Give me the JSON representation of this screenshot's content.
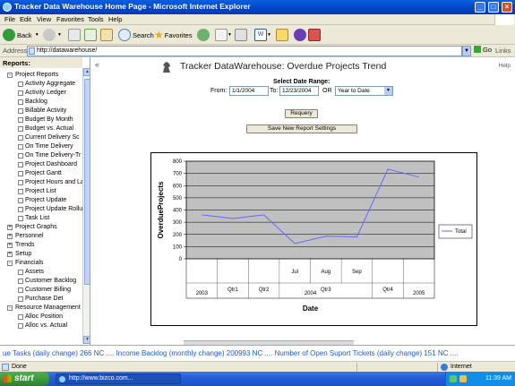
{
  "window": {
    "title": "Tracker Data Warehouse Home Page - Microsoft Internet Explorer"
  },
  "menu": [
    "File",
    "Edit",
    "View",
    "Favorites",
    "Tools",
    "Help"
  ],
  "toolbar": {
    "back_label": "Back",
    "search_label": "Search",
    "favorites_label": "Favorites"
  },
  "address": {
    "label": "Address",
    "url": "http://datawarehouse/",
    "go_label": "Go",
    "links_label": "Links"
  },
  "sidebar": {
    "header": "Reports:",
    "items": [
      {
        "label": "Project Reports",
        "level": 1,
        "expander": "-"
      },
      {
        "label": "Activity Aggregate",
        "level": 2
      },
      {
        "label": "Activity Ledger",
        "level": 2
      },
      {
        "label": "Backlog",
        "level": 2
      },
      {
        "label": "Billable Activity",
        "level": 2
      },
      {
        "label": "Budget By Month",
        "level": 2
      },
      {
        "label": "Budget vs. Actual",
        "level": 2
      },
      {
        "label": "Current Delivery Sc",
        "level": 2
      },
      {
        "label": "On Time Delivery",
        "level": 2
      },
      {
        "label": "On Time Delivery-Tr",
        "level": 2
      },
      {
        "label": "Project Dashboard",
        "level": 2
      },
      {
        "label": "Project Gantt",
        "level": 2
      },
      {
        "label": "Project Hours and La",
        "level": 2
      },
      {
        "label": "Project List",
        "level": 2
      },
      {
        "label": "Project Update",
        "level": 2
      },
      {
        "label": "Project Update Rollu",
        "level": 2
      },
      {
        "label": "Task List",
        "level": 2
      },
      {
        "label": "Project Graphs",
        "level": 1,
        "expander": "+"
      },
      {
        "label": "Personnel",
        "level": 1,
        "expander": "+"
      },
      {
        "label": "Trends",
        "level": 1,
        "expander": "+"
      },
      {
        "label": "Setup",
        "level": 1,
        "expander": "+"
      },
      {
        "label": "Financials",
        "level": 1,
        "expander": "-"
      },
      {
        "label": "Assets",
        "level": 2
      },
      {
        "label": "Customer Backlog",
        "level": 2
      },
      {
        "label": "Customer Billing",
        "level": 2
      },
      {
        "label": "Purchase Det",
        "level": 2
      },
      {
        "label": "Resource Management",
        "level": 1,
        "expander": "-"
      },
      {
        "label": "Alloc Position",
        "level": 2
      },
      {
        "label": "Alloc vs. Actual",
        "level": 2
      }
    ]
  },
  "content": {
    "collapse_glyph": "«",
    "help_label": "Help",
    "title": "Tracker DataWarehouse: Overdue Projects Trend",
    "date_range_label": "Select Date Range:",
    "from_label": "From:",
    "from_value": "1/1/2004",
    "to_label": "To:",
    "to_value": "12/23/2004",
    "or_label": "OR",
    "range_select": "Year to Date",
    "requery_label": "Requery",
    "save_label": "Save New Report Settings"
  },
  "chart_data": {
    "type": "line",
    "xlabel": "Date",
    "ylabel": "OverdueProjects",
    "ylim": [
      0,
      800
    ],
    "yticks": [
      0,
      100,
      200,
      300,
      400,
      500,
      600,
      700,
      800
    ],
    "grid": true,
    "legend_position": "right",
    "x_hierarchy": {
      "months": [
        "",
        "",
        "",
        "Jul",
        "Aug",
        "Sep",
        "",
        ""
      ],
      "quarters": [
        "",
        "Qtr1",
        "Qtr2",
        "Qtr3",
        "Qtr4",
        ""
      ],
      "years": [
        "2003",
        "2004",
        "2005"
      ]
    },
    "series": [
      {
        "name": "Total",
        "color": "#6666ff",
        "values": [
          360,
          330,
          360,
          125,
          185,
          180,
          735,
          670
        ]
      }
    ]
  },
  "ticker": "ue Tasks (daily change) 266 NC .... Income Backlog (monthly change) 200993 NC .... Number of Open Suport Tickets (daily change) 151 NC ....",
  "status": {
    "left": "Done",
    "zone": "Internet"
  },
  "taskbar": {
    "start_label": "start",
    "task_label": "http://www.bizco.com...",
    "clock": "11:39 AM"
  }
}
